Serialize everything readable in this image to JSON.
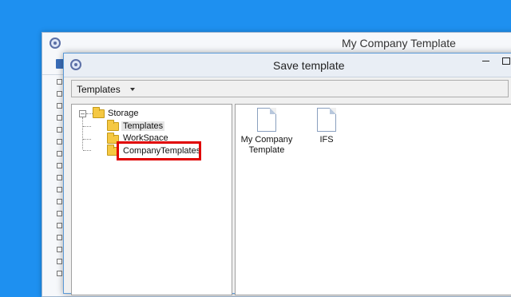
{
  "background_window": {
    "title": "My Company Template"
  },
  "dialog": {
    "title": "Save template",
    "dropdown": {
      "label": "Templates"
    },
    "tree": {
      "root": "Storage",
      "children": [
        "Templates",
        "WorkSpace",
        "CompanyTemplates"
      ],
      "selected": "Templates",
      "highlighted": "CompanyTemplates"
    },
    "files": [
      {
        "name": "My Company Template"
      },
      {
        "name": "IFS"
      }
    ]
  },
  "colors": {
    "desktop": "#1e90f0",
    "highlight_box": "#e00000"
  }
}
